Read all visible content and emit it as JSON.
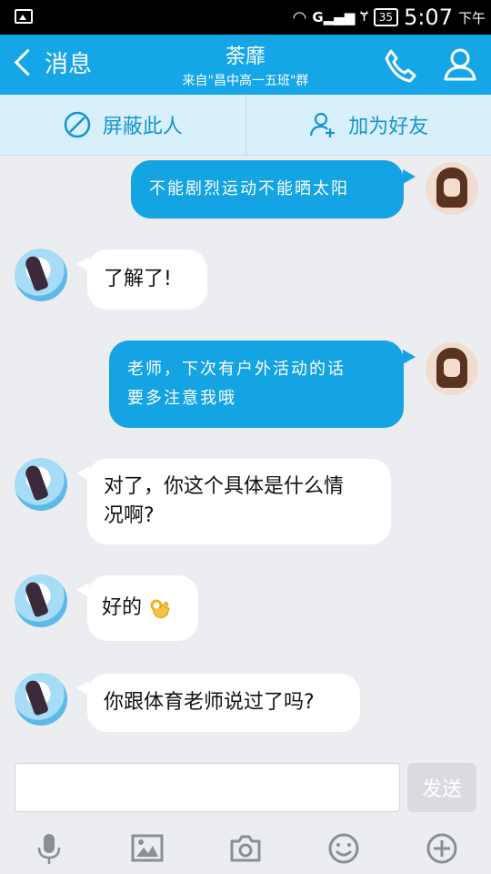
{
  "status": {
    "battery": "35",
    "time": "5:07",
    "ampm": "下午",
    "signal": "G"
  },
  "header": {
    "back_label": "消息",
    "title": "荼靡",
    "subtitle": "来自\"昌中高一五班\"群"
  },
  "actions": {
    "block_label": "屏蔽此人",
    "add_friend_label": "加为好友"
  },
  "messages": [
    {
      "side": "out",
      "text": "不能剧烈运动不能晒太阳"
    },
    {
      "side": "in",
      "text": "了解了!"
    },
    {
      "side": "out",
      "lines": [
        "老师，下次有户外活动的话",
        "要多注意我哦"
      ]
    },
    {
      "side": "in",
      "lines": [
        "对了，你这个具体是什么情",
        "况啊?"
      ]
    },
    {
      "side": "in",
      "text": "好的",
      "emoji": "ok-hand-icon"
    },
    {
      "side": "in",
      "text": "你跟体育老师说过了吗?"
    }
  ],
  "input": {
    "placeholder": "",
    "send_label": "发送"
  },
  "toolbar": [
    "microphone-icon",
    "image-icon",
    "camera-icon",
    "emoji-icon",
    "plus-icon"
  ],
  "colors": {
    "header": "#15a6e8",
    "action_bar": "#d8f0fb",
    "outgoing_bubble": "#14a3e3",
    "incoming_bubble": "#ffffff",
    "background": "#ebedf0"
  }
}
